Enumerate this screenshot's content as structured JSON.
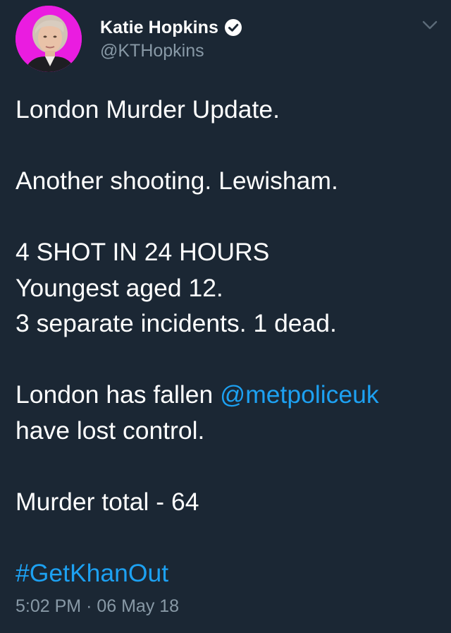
{
  "author": {
    "display_name": "Katie Hopkins",
    "handle": "@KTHopkins",
    "verified": true,
    "avatar_bg": "#ea1ce0"
  },
  "menu_icon": "chevron-down-icon",
  "tweet": {
    "line1": "London Murder Update.",
    "line2": "Another shooting. Lewisham.",
    "line3": "4 SHOT IN 24 HOURS",
    "line4": "Youngest aged 12.",
    "line5": "3 separate incidents. 1 dead.",
    "line6_pre": "London has fallen ",
    "mention": "@metpoliceuk",
    "line7": "have lost control.",
    "line8": "Murder total - 64",
    "hashtag": "#GetKhanOut"
  },
  "meta": {
    "time": "5:02 PM",
    "separator": "·",
    "date": "06 May 18"
  },
  "colors": {
    "background": "#1b2734",
    "text": "#ffffff",
    "secondary": "#8899a6",
    "link": "#1da1f2"
  }
}
